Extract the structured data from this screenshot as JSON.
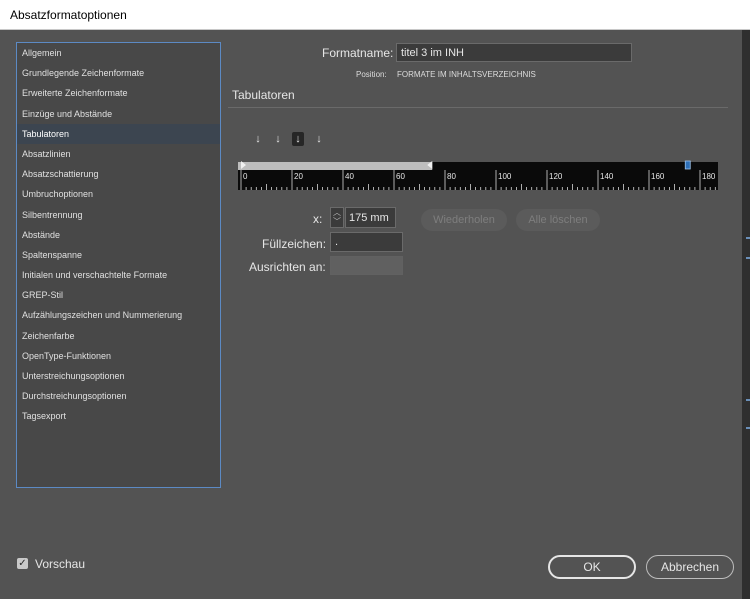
{
  "window": {
    "title": "Absatzformatoptionen"
  },
  "sidebar": {
    "items": [
      {
        "label": "Allgemein"
      },
      {
        "label": "Grundlegende Zeichenformate"
      },
      {
        "label": "Erweiterte Zeichenformate"
      },
      {
        "label": "Einzüge und Abstände"
      },
      {
        "label": "Tabulatoren",
        "selected": true
      },
      {
        "label": "Absatzlinien"
      },
      {
        "label": "Absatzschattierung"
      },
      {
        "label": "Umbruchoptionen"
      },
      {
        "label": "Silbentrennung"
      },
      {
        "label": "Abstände"
      },
      {
        "label": "Spaltenspanne"
      },
      {
        "label": "Initialen und verschachtelte Formate"
      },
      {
        "label": "GREP-Stil"
      },
      {
        "label": "Aufzählungszeichen und Nummerierung"
      },
      {
        "label": "Zeichenfarbe"
      },
      {
        "label": "OpenType-Funktionen"
      },
      {
        "label": "Unterstreichungsoptionen"
      },
      {
        "label": "Durchstreichungsoptionen"
      },
      {
        "label": "Tagsexport"
      }
    ]
  },
  "format": {
    "name_label": "Formatname:",
    "name_value": "titel 3 im INH",
    "position_label": "Position:",
    "position_value": "FORMATE IM INHALTSVERZEICHNIS"
  },
  "section": {
    "title": "Tabulatoren"
  },
  "tab_types": [
    {
      "icon": "left-tab-icon",
      "glyph": "↓"
    },
    {
      "icon": "center-tab-icon",
      "glyph": "↓"
    },
    {
      "icon": "right-tab-icon",
      "glyph": "↓",
      "active": true
    },
    {
      "icon": "decimal-tab-icon",
      "glyph": "↓"
    }
  ],
  "ruler": {
    "unit": "mm",
    "ticks": [
      "0",
      "20",
      "40",
      "60",
      "80",
      "100",
      "120",
      "140",
      "160",
      "180"
    ],
    "left_indent": 0,
    "right_indent": 75,
    "tab_stop": 175
  },
  "position": {
    "x_label": "x:",
    "x_value": "175 mm",
    "repeat_button": "Wiederholen",
    "clear_all_button": "Alle löschen"
  },
  "leader": {
    "label": "Füllzeichen:",
    "value": "."
  },
  "align_on": {
    "label": "Ausrichten an:",
    "value": ""
  },
  "preview": {
    "label": "Vorschau",
    "checked": true
  },
  "buttons": {
    "ok": "OK",
    "cancel": "Abbrechen"
  },
  "colors": {
    "accent": "#5c8ac4",
    "panel": "#535353",
    "selection": "#3c4550"
  }
}
